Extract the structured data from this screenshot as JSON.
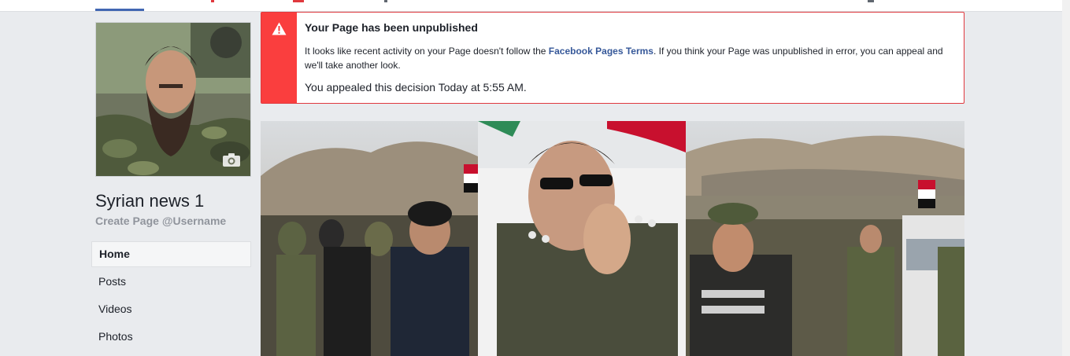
{
  "page": {
    "name": "Syrian news 1",
    "username_link": "Create Page @Username"
  },
  "nav": {
    "items": [
      {
        "label": "Home",
        "active": true
      },
      {
        "label": "Posts",
        "active": false
      },
      {
        "label": "Videos",
        "active": false
      },
      {
        "label": "Photos",
        "active": false
      }
    ]
  },
  "alert": {
    "title": "Your Page has been unpublished",
    "body_before_link": "It looks like recent activity on your Page doesn't follow the ",
    "link_text": "Facebook Pages Terms",
    "body_after_link": ". If you think your Page was unpublished in error, you can appeal and we'll take another look.",
    "appeal_status": "You appealed this decision Today at 5:55 AM.",
    "icon": "warning-triangle-icon",
    "color": "#fa3e3e"
  },
  "profile_picture": {
    "icon": "camera-icon"
  },
  "colors": {
    "background": "#e9ebee",
    "link": "#365899",
    "active_tab": "#4267b2",
    "alert_red": "#fa3e3e"
  }
}
